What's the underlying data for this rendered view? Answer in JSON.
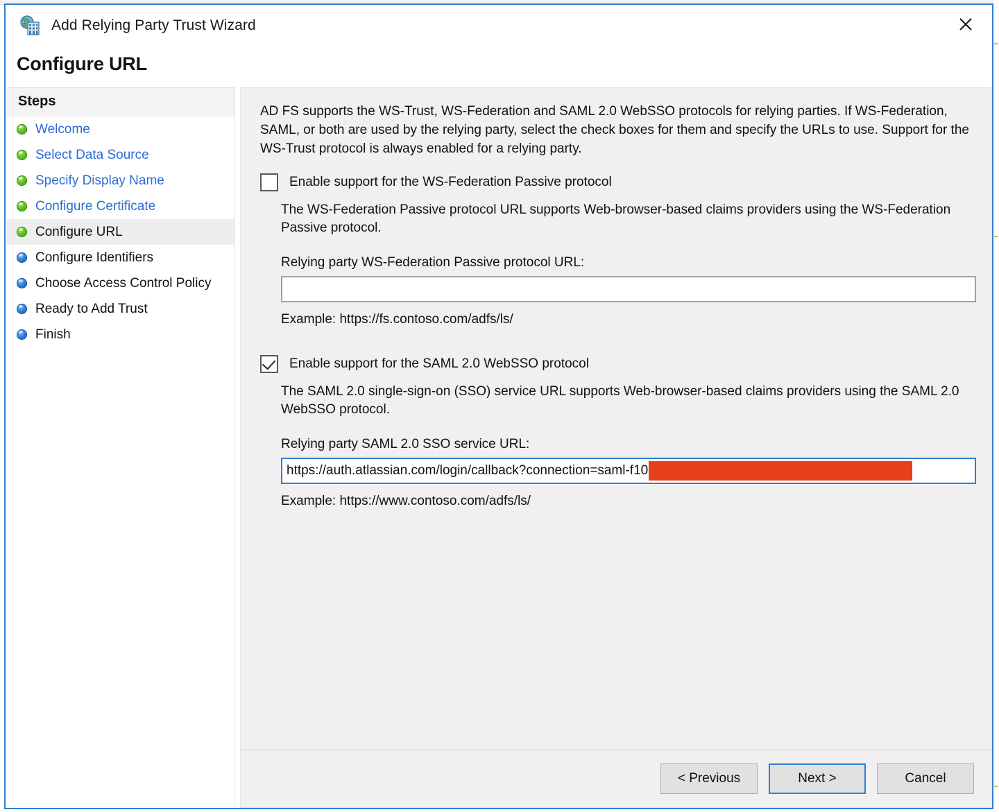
{
  "window": {
    "title": "Add Relying Party Trust Wizard",
    "icon": "relying-party-trust-icon",
    "close_label": "✕",
    "border_color": "#2e7fd1"
  },
  "page": {
    "heading": "Configure URL"
  },
  "sidebar": {
    "header": "Steps",
    "items": [
      {
        "label": "Welcome",
        "state": "done",
        "bullet": "green"
      },
      {
        "label": "Select Data Source",
        "state": "done",
        "bullet": "green"
      },
      {
        "label": "Specify Display Name",
        "state": "done",
        "bullet": "green"
      },
      {
        "label": "Configure Certificate",
        "state": "done",
        "bullet": "green"
      },
      {
        "label": "Configure URL",
        "state": "current",
        "bullet": "green"
      },
      {
        "label": "Configure Identifiers",
        "state": "future",
        "bullet": "blue"
      },
      {
        "label": "Choose Access Control Policy",
        "state": "future",
        "bullet": "blue"
      },
      {
        "label": "Ready to Add Trust",
        "state": "future",
        "bullet": "blue"
      },
      {
        "label": "Finish",
        "state": "future",
        "bullet": "blue"
      }
    ]
  },
  "main": {
    "intro": "AD FS supports the WS-Trust, WS-Federation and SAML 2.0 WebSSO protocols for relying parties.  If WS-Federation, SAML, or both are used by the relying party, select the check boxes for them and specify the URLs to use.  Support for the WS-Trust protocol is always enabled for a relying party.",
    "wsfed": {
      "checkbox_label": "Enable support for the WS-Federation Passive protocol",
      "checked": false,
      "description": "The WS-Federation Passive protocol URL supports Web-browser-based claims providers using the WS-Federation Passive protocol.",
      "field_label": "Relying party WS-Federation Passive protocol URL:",
      "field_value": "",
      "field_placeholder": "",
      "example": "Example: https://fs.contoso.com/adfs/ls/"
    },
    "saml": {
      "checkbox_label": "Enable support for the SAML 2.0 WebSSO protocol",
      "checked": true,
      "description": "The SAML 2.0 single-sign-on (SSO) service URL supports Web-browser-based claims providers using the SAML 2.0 WebSSO protocol.",
      "field_label": "Relying party SAML 2.0 SSO service URL:",
      "field_value": "https://auth.atlassian.com/login/callback?connection=saml-f10",
      "field_redacted": true,
      "redaction_color": "#e8401c",
      "example": "Example: https://www.contoso.com/adfs/ls/"
    }
  },
  "footer": {
    "previous_label": "< Previous",
    "next_label": "Next >",
    "cancel_label": "Cancel"
  }
}
